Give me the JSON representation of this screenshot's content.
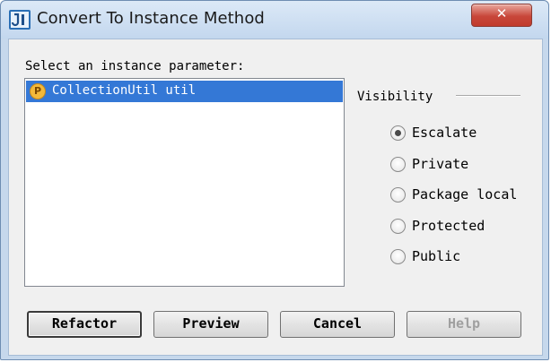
{
  "window": {
    "title": "Convert To Instance Method",
    "close_label": "✕"
  },
  "instance_parameter": {
    "label": "Select an instance parameter:",
    "items": [
      {
        "icon": "P",
        "text": "CollectionUtil util",
        "selected": true
      }
    ]
  },
  "visibility": {
    "label": "Visibility",
    "options": [
      {
        "label": "Escalate",
        "checked": true
      },
      {
        "label": "Private",
        "checked": false
      },
      {
        "label": "Package local",
        "checked": false
      },
      {
        "label": "Protected",
        "checked": false
      },
      {
        "label": "Public",
        "checked": false
      }
    ]
  },
  "buttons": {
    "refactor": "Refactor",
    "preview": "Preview",
    "cancel": "Cancel",
    "help": "Help"
  },
  "colors": {
    "selection": "#3478d6",
    "param_badge": "#f3b93a"
  }
}
